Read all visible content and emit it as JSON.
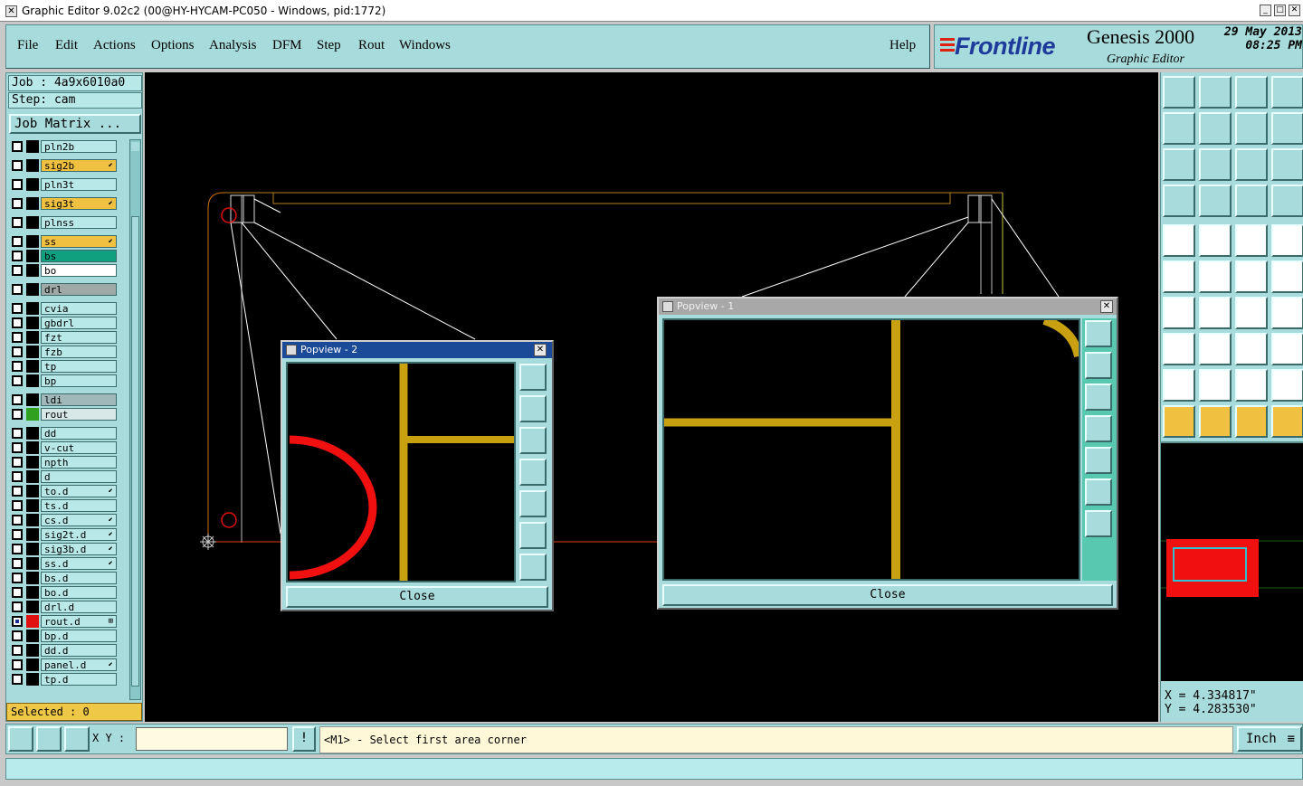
{
  "window": {
    "title": "Graphic Editor 9.02c2 (00@HY-HYCAM-PC050 - Windows, pid:1772)",
    "controls": [
      "_",
      "□",
      "✕"
    ]
  },
  "menu": [
    "File",
    "Edit",
    "Actions",
    "Options",
    "Analysis",
    "DFM",
    "Step",
    "Rout",
    "Windows"
  ],
  "help_label": "Help",
  "brand": {
    "logo": "Frontline",
    "product": "Genesis 2000",
    "subtitle": "Graphic Editor",
    "date": "29 May 2013",
    "time": "08:25 PM"
  },
  "job": {
    "job_label": "Job : 4a9x6010a0",
    "step_label": "Step: cam",
    "matrix_button": "Job Matrix ..."
  },
  "layers": [
    {
      "name": "pln2b",
      "bg": "#b8e8e8",
      "mark": "",
      "swatch": "#000000"
    },
    {
      "name": "sig2b",
      "bg": "#f0c040",
      "mark": "⬋",
      "swatch": "#000000"
    },
    {
      "name": "pln3t",
      "bg": "#b8e8e8",
      "mark": "",
      "swatch": "#000000"
    },
    {
      "name": "sig3t",
      "bg": "#f0c040",
      "mark": "⬋",
      "swatch": "#000000"
    },
    {
      "name": "plnss",
      "bg": "#b8e8e8",
      "mark": "",
      "swatch": "#000000"
    },
    {
      "name": "ss",
      "bg": "#f0c040",
      "mark": "⬋",
      "swatch": "#000000"
    },
    {
      "name": "bs",
      "bg": "#10a080",
      "mark": "",
      "swatch": "#000000"
    },
    {
      "name": "bo",
      "bg": "#ffffff",
      "mark": "",
      "swatch": "#000000"
    },
    {
      "name": "drl",
      "bg": "#a0a8a8",
      "mark": "",
      "swatch": "#000000"
    },
    {
      "name": "cvia",
      "bg": "#b8e8e8",
      "mark": "",
      "swatch": "#000000"
    },
    {
      "name": "gbdrl",
      "bg": "#b8e8e8",
      "mark": "",
      "swatch": "#000000"
    },
    {
      "name": "fzt",
      "bg": "#b8e8e8",
      "mark": "",
      "swatch": "#000000"
    },
    {
      "name": "fzb",
      "bg": "#b8e8e8",
      "mark": "",
      "swatch": "#000000"
    },
    {
      "name": "tp",
      "bg": "#b8e8e8",
      "mark": "",
      "swatch": "#000000"
    },
    {
      "name": "bp",
      "bg": "#b8e8e8",
      "mark": "",
      "swatch": "#000000"
    },
    {
      "name": "ldi",
      "bg": "#a0b8b8",
      "mark": "",
      "swatch": "#000000"
    },
    {
      "name": "rout",
      "bg": "#d8e8e8",
      "mark": "",
      "swatch": "#30a020"
    },
    {
      "name": "dd",
      "bg": "#b8e8e8",
      "mark": "",
      "swatch": "#000000"
    },
    {
      "name": "v-cut",
      "bg": "#b8e8e8",
      "mark": "",
      "swatch": "#000000"
    },
    {
      "name": "npth",
      "bg": "#b8e8e8",
      "mark": "",
      "swatch": "#000000"
    },
    {
      "name": "d",
      "bg": "#b8e8e8",
      "mark": "",
      "swatch": "#000000"
    },
    {
      "name": "to.d",
      "bg": "#b8e8e8",
      "mark": "⬋",
      "swatch": "#000000"
    },
    {
      "name": "ts.d",
      "bg": "#b8e8e8",
      "mark": "",
      "swatch": "#000000"
    },
    {
      "name": "cs.d",
      "bg": "#b8e8e8",
      "mark": "⬋",
      "swatch": "#000000"
    },
    {
      "name": "sig2t.d",
      "bg": "#b8e8e8",
      "mark": "⬋",
      "swatch": "#000000"
    },
    {
      "name": "sig3b.d",
      "bg": "#b8e8e8",
      "mark": "⬋",
      "swatch": "#000000"
    },
    {
      "name": "ss.d",
      "bg": "#b8e8e8",
      "mark": "⬋",
      "swatch": "#000000"
    },
    {
      "name": "bs.d",
      "bg": "#b8e8e8",
      "mark": "",
      "swatch": "#000000"
    },
    {
      "name": "bo.d",
      "bg": "#b8e8e8",
      "mark": "",
      "swatch": "#000000"
    },
    {
      "name": "drl.d",
      "bg": "#b8e8e8",
      "mark": "",
      "swatch": "#000000"
    },
    {
      "name": "rout.d",
      "bg": "#b8e8e8",
      "mark": "⊞",
      "swatch": "#e01010",
      "checked": true
    },
    {
      "name": "bp.d",
      "bg": "#b8e8e8",
      "mark": "",
      "swatch": "#000000"
    },
    {
      "name": "dd.d",
      "bg": "#b8e8e8",
      "mark": "",
      "swatch": "#000000"
    },
    {
      "name": "panel.d",
      "bg": "#b8e8e8",
      "mark": "⬋",
      "swatch": "#000000"
    },
    {
      "name": "tp.d",
      "bg": "#b8e8e8",
      "mark": "",
      "swatch": "#000000"
    }
  ],
  "selected_label": "Selected : 0",
  "popview2": {
    "title": "Popview - 2",
    "close_label": "Close"
  },
  "popview1": {
    "title": "Popview - 1",
    "close_label": "Close"
  },
  "coords": {
    "x": "X = 4.334817\"",
    "y": "Y = 4.283530\""
  },
  "command": {
    "xy_label": "X Y :",
    "xy_value": "",
    "message": "<M1> - Select first area corner",
    "unit": "Inch"
  },
  "colors": {
    "panel": "#a8dcdc",
    "rout": "#e01010",
    "trace": "#c8a010",
    "outline": "#b08020"
  }
}
